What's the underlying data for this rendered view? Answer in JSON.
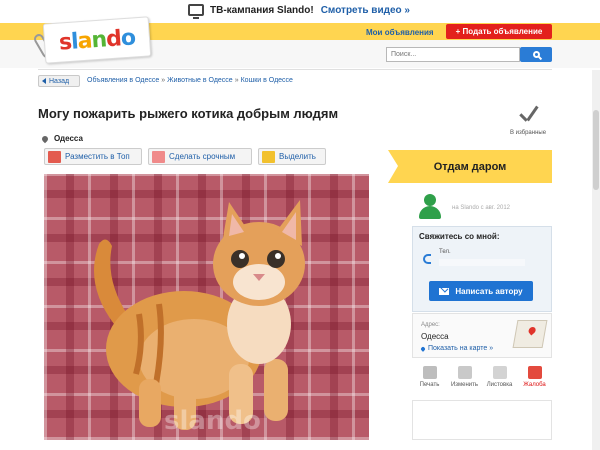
{
  "promo": {
    "text": "ТВ-кампания Slando!",
    "link": "Смотреть видео »"
  },
  "header": {
    "logo": "slando",
    "my_ads": "Мои объявления",
    "post_ad": "+ Подать объявление",
    "search_placeholder": "Поиск..."
  },
  "breadcrumb": {
    "back": "Назад",
    "items": [
      "Объявления в Одессе",
      "Животные в Одессе",
      "Кошки в Одессе"
    ],
    "separator": "»"
  },
  "ad": {
    "title": "Могу пожарить рыжего котика добрым людям",
    "favorite": "В избранные",
    "location": "Одесса",
    "actions": [
      "Разместить в Топ",
      "Сделать срочным",
      "Выделить"
    ],
    "watermark": "slando"
  },
  "sidebar": {
    "badge": "Отдам даром",
    "seller_since": "на Slando с авг. 2012",
    "contact_title": "Свяжитесь со мной:",
    "phone_label": "Тел.",
    "write_button": "Написать автору",
    "address_label": "Адрес:",
    "address_city": "Одесса",
    "show_map": "Показать на карте »",
    "tools": [
      "Печать",
      "Изменить",
      "Листовка",
      "Жалоба"
    ]
  },
  "colors": {
    "brand_yellow": "#ffd550",
    "accent_red": "#e3201c",
    "link_blue": "#1f5fa8",
    "button_blue": "#1f73d2",
    "seller_green": "#2fa04a"
  }
}
